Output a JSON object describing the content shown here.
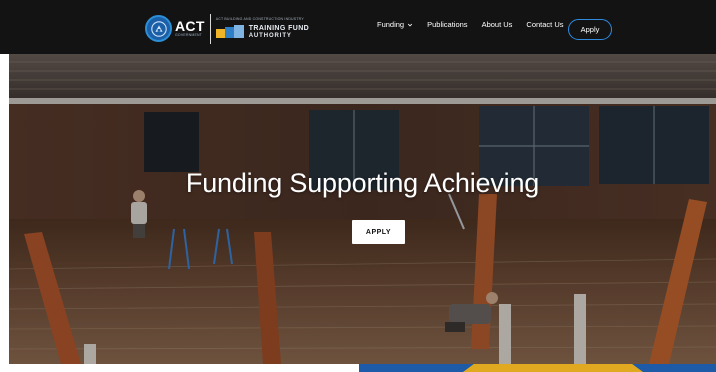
{
  "header": {
    "logo_primary": "ACT",
    "logo_primary_sub": "GOVERNMENT",
    "logo_secondary_tagline": "ACT BUILDING AND CONSTRUCTION INDUSTRY",
    "logo_secondary_line1": "TRAINING FUND",
    "logo_secondary_line2": "AUTHORITY",
    "nav": [
      {
        "label": "Funding",
        "has_dropdown": true
      },
      {
        "label": "Publications",
        "has_dropdown": false
      },
      {
        "label": "About Us",
        "has_dropdown": false
      },
      {
        "label": "Contact Us",
        "has_dropdown": false
      }
    ],
    "apply_label": "Apply"
  },
  "hero": {
    "title": "Funding Supporting Achieving",
    "cta_label": "APPLY"
  },
  "colors": {
    "header_bg": "#131313",
    "accent_blue": "#2f8ae0",
    "brand_blue": "#1d5aa7",
    "brand_gold": "#e0a91f"
  },
  "icons": {
    "dropdown": "chevron-down-icon",
    "seal": "act-seal-icon"
  }
}
